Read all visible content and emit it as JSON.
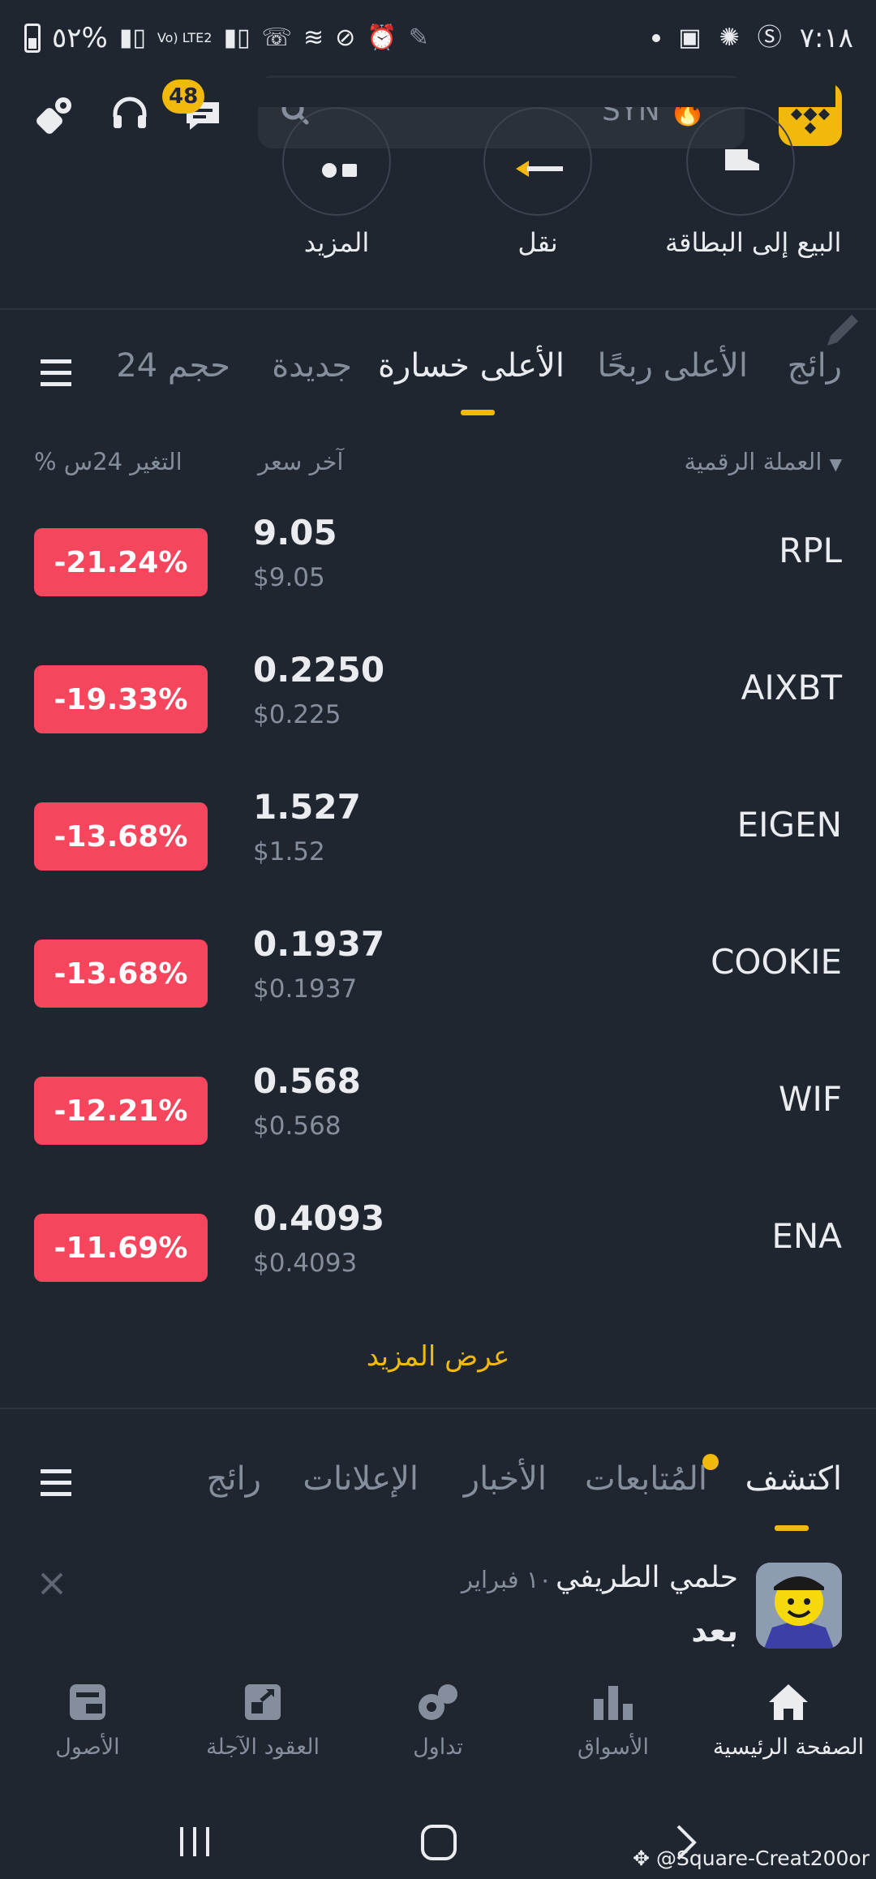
{
  "status_bar": {
    "battery_text": "٥٢%",
    "network": "Vo) LTE2",
    "time": "٧:١٨"
  },
  "header": {
    "notification_count": "48",
    "search_placeholder": "SYN 🔥"
  },
  "quick_actions": [
    {
      "label": "البيع إلى البطاقة",
      "icon": "card-sell-icon"
    },
    {
      "label": "نقل",
      "icon": "transfer-arrow-icon"
    },
    {
      "label": "المزيد",
      "icon": "more-grid-icon"
    }
  ],
  "market_tabs": {
    "items": [
      "رائج",
      "الأعلى ربحًا",
      "الأعلى خسارة",
      "جديدة",
      "حجم 24"
    ],
    "active_index": 2
  },
  "column_headers": {
    "coin": "العملة الرقمية",
    "last_price": "آخر سعر",
    "change_24h": "% التغير 24س"
  },
  "coins": [
    {
      "symbol": "RPL",
      "price": "9.05",
      "usd": "$9.05",
      "change": "-21.24%"
    },
    {
      "symbol": "AIXBT",
      "price": "0.2250",
      "usd": "$0.225",
      "change": "-19.33%"
    },
    {
      "symbol": "EIGEN",
      "price": "1.527",
      "usd": "$1.52",
      "change": "-13.68%"
    },
    {
      "symbol": "COOKIE",
      "price": "0.1937",
      "usd": "$0.1937",
      "change": "-13.68%"
    },
    {
      "symbol": "WIF",
      "price": "0.568",
      "usd": "$0.568",
      "change": "-12.21%"
    },
    {
      "symbol": "ENA",
      "price": "0.4093",
      "usd": "$0.4093",
      "change": "-11.69%"
    }
  ],
  "view_more": "عرض المزيد",
  "feed_tabs": {
    "items": [
      "اكتشف",
      "المُتابعات",
      "الأخبار",
      "الإعلانات",
      "رائج"
    ],
    "active_index": 0
  },
  "post": {
    "author": "حلمي الطريفي",
    "date": "١٠ فبراير",
    "text": "بعد"
  },
  "bottom_nav": [
    {
      "label": "الصفحة الرئيسية",
      "icon": "home-icon",
      "active": true
    },
    {
      "label": "الأسواق",
      "icon": "markets-icon",
      "active": false
    },
    {
      "label": "تداول",
      "icon": "trade-icon",
      "active": false
    },
    {
      "label": "العقود الآجلة",
      "icon": "futures-icon",
      "active": false
    },
    {
      "label": "الأصول",
      "icon": "wallet-icon",
      "active": false
    }
  ],
  "watermark": "@Square-Creat200or",
  "colors": {
    "background": "#202630",
    "accent": "#F0B90B",
    "loss": "#F6465D",
    "text_primary": "#EAECEF",
    "text_secondary": "#848E9C"
  }
}
